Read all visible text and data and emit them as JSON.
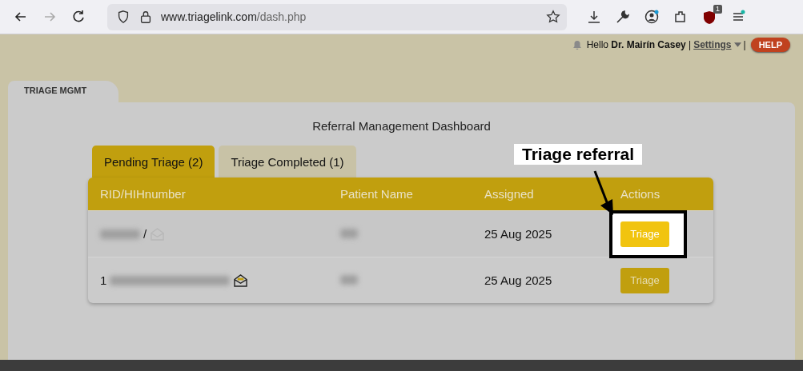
{
  "browser": {
    "url_host": "www.triagelink.com",
    "url_path": "/dash.php",
    "forward_disabled": true,
    "extension_badge": "1"
  },
  "header": {
    "greeting": "Hello",
    "user": "Dr. Mairín Casey",
    "separator": "|",
    "settings": "Settings",
    "separator_2": "|",
    "help": "HELP"
  },
  "module_tab": {
    "label": "TRIAGE MGMT"
  },
  "dashboard_title": "Referral Management Dashboard",
  "tabs": [
    {
      "label": "Pending Triage (2)",
      "selected": true
    },
    {
      "label": "Triage Completed (1)",
      "selected": false
    }
  ],
  "table": {
    "columns": [
      "RID/HIHnumber",
      "Patient Name",
      "Assigned",
      "Actions"
    ],
    "rows": [
      {
        "rid_prefix": "",
        "rid_suffix": "/",
        "message_read": true,
        "assigned": "25 Aug 2025",
        "action": "Triage",
        "highlighted": true
      },
      {
        "rid_prefix": "1",
        "rid_suffix": "",
        "message_read": false,
        "assigned": "25 Aug 2025",
        "action": "Triage",
        "highlighted": false
      }
    ]
  },
  "annotation": {
    "label": "Triage referral"
  }
}
